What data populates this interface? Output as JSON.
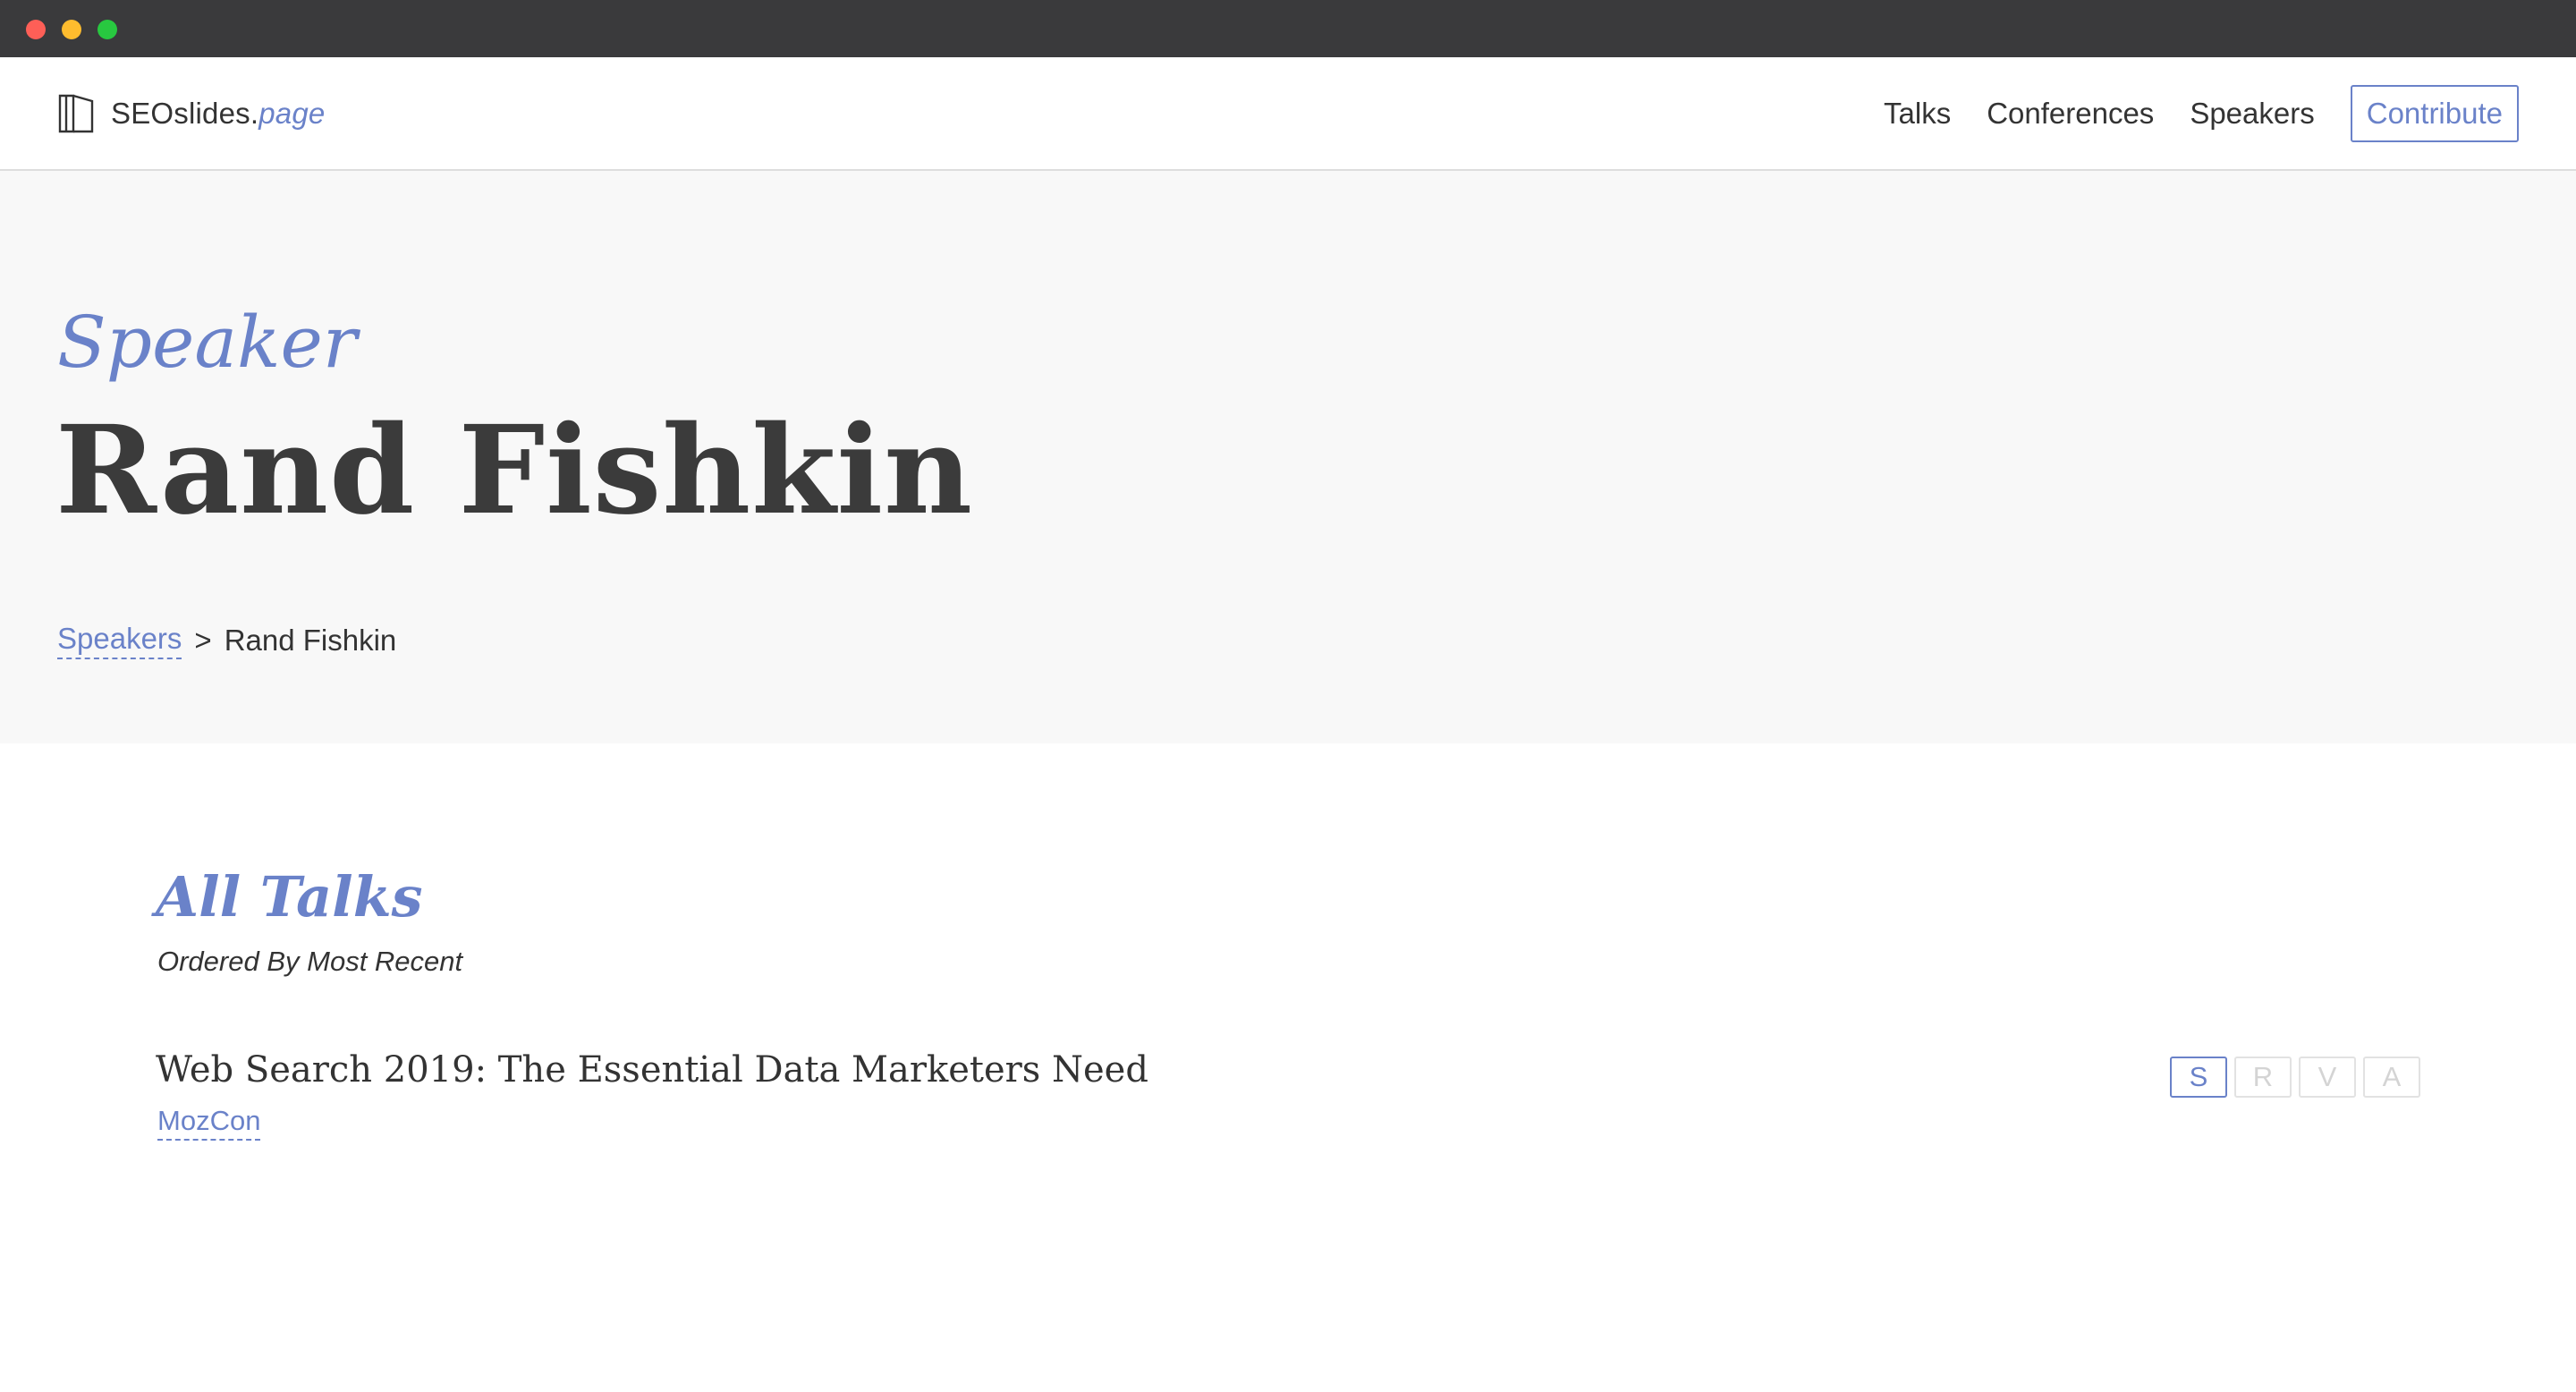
{
  "brand": {
    "name": "SEOslides.",
    "suffix": "page",
    "icon": "book-icon"
  },
  "nav": {
    "links": [
      "Talks",
      "Conferences",
      "Speakers"
    ],
    "contribute": "Contribute"
  },
  "hero": {
    "kicker": "Speaker",
    "title": "Rand Fishkin",
    "breadcrumb": {
      "parent": "Speakers",
      "separator": ">",
      "current": "Rand Fishkin"
    }
  },
  "talks_section": {
    "title": "All Talks",
    "subtitle": "Ordered By Most Recent",
    "items": [
      {
        "title": "Web Search 2019: The Essential Data Marketers Need",
        "conference": "MozCon",
        "badges": [
          {
            "label": "S",
            "active": true
          },
          {
            "label": "R",
            "active": false
          },
          {
            "label": "V",
            "active": false
          },
          {
            "label": "A",
            "active": false
          }
        ]
      }
    ]
  },
  "colors": {
    "accent": "#6a82c9",
    "text": "#333333",
    "hero_bg": "#f8f8f8",
    "titlebar": "#3a3a3c"
  }
}
